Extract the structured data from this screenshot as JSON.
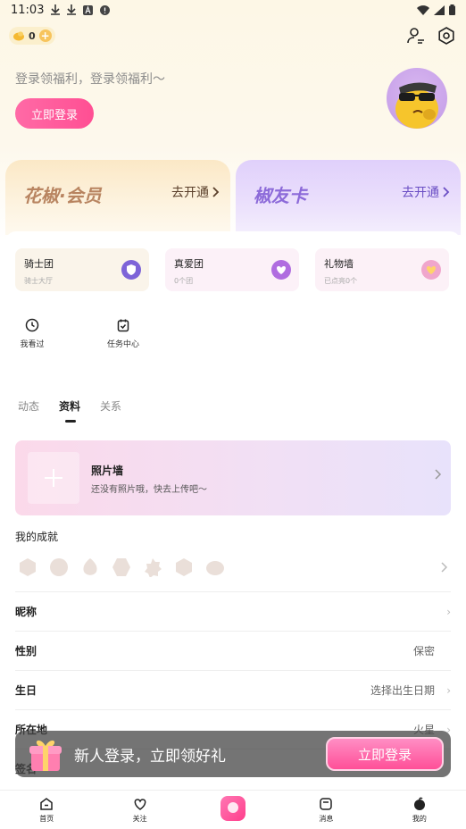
{
  "status_bar": {
    "time": "11:03"
  },
  "header": {
    "coin_count": "0"
  },
  "login": {
    "tip": "登录领福利，登录领福利～",
    "button": "立即登录"
  },
  "membership": [
    {
      "title": "花椒·会员",
      "action": "去开通"
    },
    {
      "title": "椒友卡",
      "action": "去开通"
    }
  ],
  "groups": [
    {
      "title": "骑士团",
      "sub": "骑士大厅"
    },
    {
      "title": "真爱团",
      "sub": "0个团"
    },
    {
      "title": "礼物墙",
      "sub": "已点亮0个"
    }
  ],
  "quick_links": [
    {
      "label": "我看过"
    },
    {
      "label": "任务中心"
    }
  ],
  "tabs": [
    {
      "label": "动态"
    },
    {
      "label": "资料"
    },
    {
      "label": "关系"
    }
  ],
  "photo_wall": {
    "title": "照片墙",
    "subtitle": "还没有照片哦，快去上传吧～"
  },
  "achievements": {
    "title": "我的成就"
  },
  "profile_rows": [
    {
      "label": "昵称",
      "value": ""
    },
    {
      "label": "性别",
      "value": "保密"
    },
    {
      "label": "生日",
      "value": "选择出生日期"
    },
    {
      "label": "所在地",
      "value": "火星"
    },
    {
      "label": "签名",
      "value": ""
    }
  ],
  "promo": {
    "text": "新人登录，立即领好礼",
    "button": "立即登录"
  },
  "bottom_nav": [
    {
      "label": "首页"
    },
    {
      "label": "关注"
    },
    {
      "label": ""
    },
    {
      "label": "消息"
    },
    {
      "label": "我的"
    }
  ],
  "colors": {
    "accent": "#ff4f93",
    "gold": "#b88460",
    "purple": "#8c6ad9"
  }
}
